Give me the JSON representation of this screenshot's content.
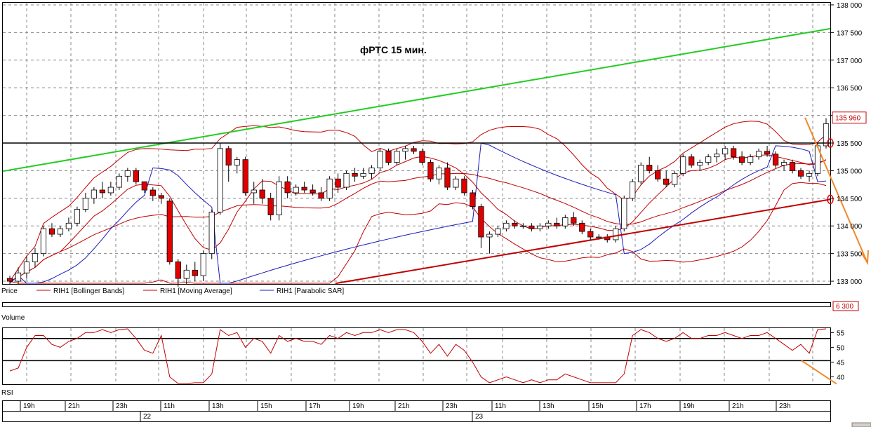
{
  "chart_data": [
    {
      "type": "candlestick",
      "title": "фРТС   15 мин.",
      "panel_label": "Price",
      "legend": [
        {
          "name": "RIH1 [Bollinger Bands]",
          "color": "#c00000"
        },
        {
          "name": "RIH1 [Moving Average]",
          "color": "#c00000"
        },
        {
          "name": "RIH1 [Parabolic SAR]",
          "color": "#1b1bbb"
        }
      ],
      "y_ticks": [
        "138 000",
        "137 500",
        "137 000",
        "136 500",
        "136 000",
        "135 500",
        "135 000",
        "134 500",
        "134 000",
        "133 500",
        "133 000"
      ],
      "y_tick_values": [
        138000,
        137500,
        137000,
        136500,
        136000,
        135500,
        135000,
        134500,
        134000,
        133500,
        133000
      ],
      "ylim": [
        132950,
        138050
      ],
      "last_price_label": "135 960",
      "last_price": 135960,
      "n_bars": 98,
      "candles": [
        [
          133050,
          133100,
          132950,
          133000
        ],
        [
          133000,
          133250,
          132950,
          133150
        ],
        [
          133150,
          133450,
          133050,
          133350
        ],
        [
          133350,
          133600,
          133250,
          133500
        ],
        [
          133500,
          134000,
          133450,
          133950
        ],
        [
          133950,
          134050,
          133800,
          133850
        ],
        [
          133850,
          134000,
          133800,
          133950
        ],
        [
          133950,
          134150,
          133900,
          134050
        ],
        [
          134050,
          134350,
          134000,
          134300
        ],
        [
          134300,
          134600,
          134250,
          134500
        ],
        [
          134500,
          134700,
          134400,
          134650
        ],
        [
          134650,
          134800,
          134500,
          134600
        ],
        [
          134600,
          134800,
          134550,
          134700
        ],
        [
          134700,
          134950,
          134650,
          134900
        ],
        [
          134900,
          135050,
          134800,
          135000
        ],
        [
          135000,
          135050,
          134750,
          134800
        ],
        [
          134800,
          134800,
          134600,
          134650
        ],
        [
          134650,
          134700,
          134450,
          134550
        ],
        [
          134550,
          134600,
          134400,
          134500
        ],
        [
          134450,
          134500,
          133300,
          133350
        ],
        [
          133350,
          133400,
          132900,
          133050
        ],
        [
          133050,
          133300,
          132950,
          133200
        ],
        [
          133200,
          133350,
          133000,
          133100
        ],
        [
          133100,
          133550,
          133000,
          133500
        ],
        [
          133500,
          134300,
          133400,
          134250
        ],
        [
          134250,
          135500,
          134200,
          135400
        ],
        [
          135400,
          135450,
          134800,
          135100
        ],
        [
          135100,
          135250,
          134950,
          135200
        ],
        [
          135200,
          135250,
          134550,
          134600
        ],
        [
          134600,
          134800,
          134400,
          134650
        ],
        [
          134650,
          134850,
          134400,
          134500
        ],
        [
          134500,
          134600,
          134100,
          134200
        ],
        [
          134200,
          134900,
          134100,
          134800
        ],
        [
          134800,
          134900,
          134500,
          134600
        ],
        [
          134600,
          134750,
          134550,
          134700
        ],
        [
          134700,
          134800,
          134600,
          134650
        ],
        [
          134650,
          134750,
          134550,
          134600
        ],
        [
          134600,
          134700,
          134450,
          134500
        ],
        [
          134500,
          134900,
          134450,
          134850
        ],
        [
          134850,
          134950,
          134600,
          134700
        ],
        [
          134700,
          135000,
          134650,
          134950
        ],
        [
          134950,
          135050,
          134800,
          134900
        ],
        [
          134900,
          135050,
          134850,
          134950
        ],
        [
          134950,
          135100,
          134850,
          135050
        ],
        [
          135050,
          135400,
          135000,
          135350
        ],
        [
          135350,
          135400,
          135100,
          135150
        ],
        [
          135150,
          135400,
          135100,
          135350
        ],
        [
          135350,
          135450,
          135200,
          135400
        ],
        [
          135400,
          135450,
          135300,
          135350
        ],
        [
          135350,
          135400,
          135100,
          135150
        ],
        [
          135150,
          135200,
          134800,
          134850
        ],
        [
          134850,
          135100,
          134750,
          135050
        ],
        [
          135050,
          135150,
          134650,
          134700
        ],
        [
          134700,
          134900,
          134650,
          134850
        ],
        [
          134850,
          134900,
          134550,
          134600
        ],
        [
          134600,
          134650,
          134300,
          134350
        ],
        [
          134350,
          134400,
          133600,
          133800
        ],
        [
          133800,
          133900,
          133500,
          133850
        ],
        [
          133850,
          134000,
          133800,
          133950
        ],
        [
          133950,
          134100,
          133900,
          134050
        ],
        [
          134050,
          134100,
          133950,
          134000
        ],
        [
          134000,
          134050,
          133950,
          134000
        ],
        [
          134000,
          134050,
          133900,
          133950
        ],
        [
          133950,
          134050,
          133900,
          134000
        ],
        [
          134000,
          134100,
          133950,
          134050
        ],
        [
          134050,
          134150,
          133950,
          134000
        ],
        [
          134000,
          134200,
          133950,
          134150
        ],
        [
          134150,
          134250,
          134000,
          134050
        ],
        [
          134050,
          134100,
          133850,
          133900
        ],
        [
          133900,
          133950,
          133750,
          133800
        ],
        [
          133800,
          133850,
          133750,
          133800
        ],
        [
          133800,
          133850,
          133700,
          133750
        ],
        [
          133750,
          134000,
          133700,
          133950
        ],
        [
          133950,
          134550,
          133900,
          134500
        ],
        [
          134500,
          134850,
          134450,
          134800
        ],
        [
          134800,
          135150,
          134750,
          135100
        ],
        [
          135100,
          135250,
          134950,
          135000
        ],
        [
          135000,
          135100,
          134800,
          134850
        ],
        [
          134850,
          135000,
          134700,
          134750
        ],
        [
          134750,
          135000,
          134700,
          134950
        ],
        [
          134950,
          135300,
          134900,
          135250
        ],
        [
          135250,
          135300,
          135050,
          135100
        ],
        [
          135100,
          135200,
          135000,
          135150
        ],
        [
          135150,
          135300,
          135100,
          135250
        ],
        [
          135250,
          135400,
          135150,
          135300
        ],
        [
          135300,
          135450,
          135200,
          135400
        ],
        [
          135400,
          135450,
          135200,
          135250
        ],
        [
          135250,
          135350,
          135100,
          135150
        ],
        [
          135150,
          135300,
          135100,
          135250
        ],
        [
          135250,
          135400,
          135200,
          135350
        ],
        [
          135350,
          135450,
          135250,
          135300
        ],
        [
          135300,
          135350,
          135050,
          135100
        ],
        [
          135100,
          135200,
          135000,
          135150
        ],
        [
          135150,
          135200,
          134950,
          135000
        ],
        [
          135000,
          135050,
          134850,
          134900
        ],
        [
          134900,
          135000,
          134800,
          134950
        ],
        [
          134950,
          135500,
          134900,
          135450
        ],
        [
          135450,
          135950,
          135400,
          135850
        ]
      ],
      "x_time_ticks": [
        "19h",
        "21h",
        "23h",
        "11h",
        "13h",
        "15h",
        "17h",
        "19h",
        "21h",
        "23h",
        "11h",
        "13h",
        "15h",
        "17h",
        "19h",
        "21h",
        "23h"
      ],
      "x_date_ticks": [
        "22",
        "23"
      ]
    },
    {
      "type": "bar",
      "panel_label": "Volume",
      "last_value_label": "6 300",
      "last_value": 6300
    },
    {
      "type": "line",
      "panel_label": "RSI",
      "y_ticks": [
        "55",
        "50",
        "45",
        "40"
      ],
      "y_tick_values": [
        55,
        50,
        45,
        40
      ],
      "ylim": [
        37.5,
        56.5
      ],
      "levels": [
        53,
        45.5
      ],
      "values": [
        42,
        43,
        50,
        54,
        54,
        51,
        50,
        52,
        53,
        55,
        55,
        56,
        55,
        56,
        57,
        53,
        49,
        48,
        54,
        40,
        37,
        37,
        38,
        38,
        41,
        56,
        54,
        55,
        50,
        53,
        52,
        48,
        54,
        52,
        53,
        52,
        52,
        51,
        54,
        53,
        55,
        54,
        55,
        55,
        56,
        55,
        56,
        56,
        55,
        52,
        48,
        51,
        47,
        51,
        49,
        45,
        40,
        38,
        39,
        40,
        39,
        38,
        39,
        38,
        39,
        39,
        41,
        40,
        39,
        38,
        38,
        38,
        38,
        41,
        54,
        56,
        55,
        53,
        52,
        53,
        55,
        53,
        53,
        54,
        54,
        55,
        54,
        53,
        54,
        54,
        55,
        53,
        51,
        49,
        51,
        48,
        56,
        58
      ]
    }
  ]
}
